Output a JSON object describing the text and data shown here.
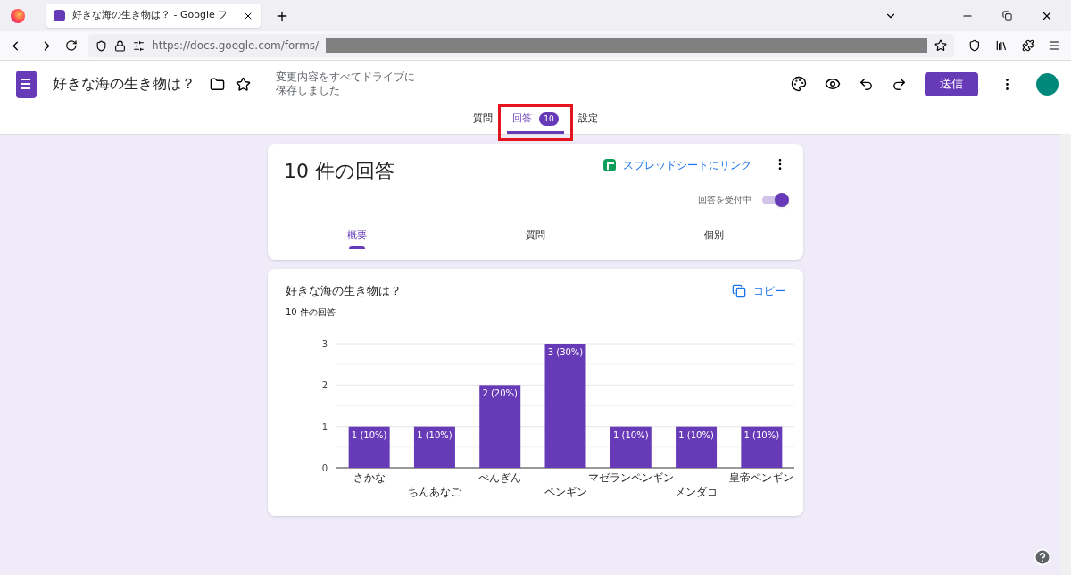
{
  "browser": {
    "tab_title": "好きな海の生き物は？ - Google フ",
    "url": "https://docs.google.com/forms/"
  },
  "header": {
    "title": "好きな海の生き物は？",
    "save_status": "変更内容をすべてドライブに保存しました",
    "send_button": "送信"
  },
  "tabs": [
    {
      "label": "質問",
      "selected": false
    },
    {
      "label": "回答",
      "badge": "10",
      "selected": true
    },
    {
      "label": "設定",
      "selected": false
    }
  ],
  "summary": {
    "title": "10 件の回答",
    "sheet_link": "スプレッドシートにリンク",
    "accepting": {
      "label": "回答を受付中",
      "on": true
    },
    "subtabs": [
      {
        "label": "概要",
        "selected": true
      },
      {
        "label": "質問",
        "selected": false
      },
      {
        "label": "個別",
        "selected": false
      }
    ]
  },
  "question": {
    "title": "好きな海の生き物は？",
    "count": "10 件の回答",
    "copy": "コピー",
    "chart_data": {
      "type": "bar",
      "categories": [
        "さかな",
        "ちんあなご",
        "ぺんぎん",
        "ペンギン",
        "マゼランペンギン",
        "メンダコ",
        "皇帝ペンギン"
      ],
      "series": [
        {
          "color": "#673ab7",
          "values": [
            1,
            1,
            2,
            3,
            1,
            1,
            1
          ]
        }
      ],
      "value_labels": [
        "1 (10%)",
        "1 (10%)",
        "2 (20%)",
        "3 (30%)",
        "1 (10%)",
        "1 (10%)",
        "1 (10%)"
      ],
      "ylim": [
        0,
        3
      ],
      "yticks": [
        0,
        1,
        2,
        3
      ]
    }
  }
}
